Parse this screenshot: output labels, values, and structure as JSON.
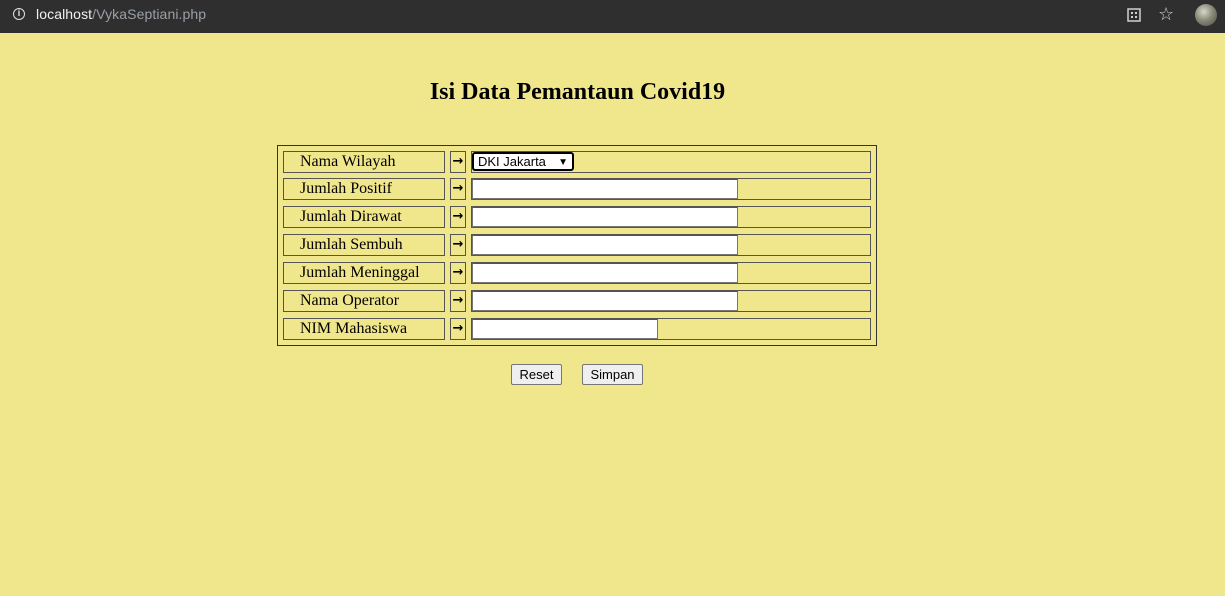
{
  "browser": {
    "url_host": "localhost",
    "url_path": "/VykaSeptiani.php",
    "icons": [
      "info-icon",
      "extension-icon",
      "star-icon",
      "avatar"
    ]
  },
  "page": {
    "title": "Isi Data Pemantaun Covid19",
    "background": "#f0e68c"
  },
  "form": {
    "arrow": "→",
    "fields": [
      {
        "label": "Nama Wilayah",
        "type": "select",
        "value": "DKI Jakarta"
      },
      {
        "label": "Jumlah Positif",
        "type": "text",
        "value": ""
      },
      {
        "label": "Jumlah Dirawat",
        "type": "text",
        "value": ""
      },
      {
        "label": "Jumlah Sembuh",
        "type": "text",
        "value": ""
      },
      {
        "label": "Jumlah Meninggal",
        "type": "text",
        "value": ""
      },
      {
        "label": "Nama Operator",
        "type": "text",
        "value": ""
      },
      {
        "label": "NIM Mahasiswa",
        "type": "text",
        "value": ""
      }
    ]
  },
  "buttons": {
    "reset_label": "Reset",
    "save_label": "Simpan"
  }
}
